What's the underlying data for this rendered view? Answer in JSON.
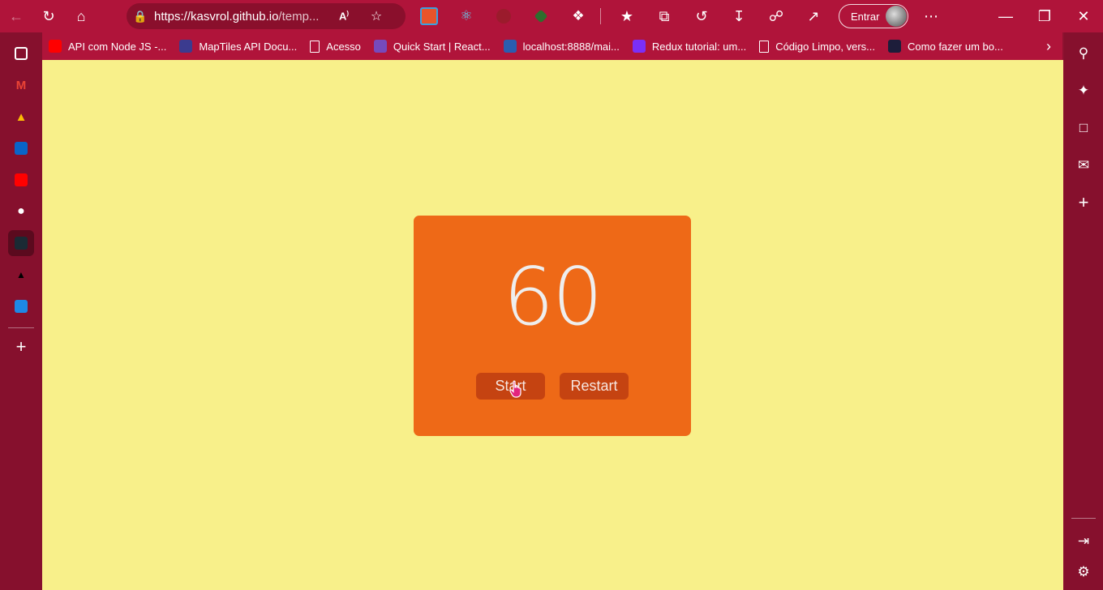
{
  "browser": {
    "url_domain": "https://kasvrol.github.io",
    "url_rest": "/temp...",
    "read_aloud_label": "A",
    "signin_label": "Entrar"
  },
  "favorites": [
    {
      "label": "API com Node JS -...",
      "icon": "youtube-icon",
      "color": "#ff0000"
    },
    {
      "label": "MapTiles API Docu...",
      "icon": "maptiles-icon",
      "color": "#3b3b8f"
    },
    {
      "label": "Acesso",
      "icon": "page-icon",
      "color": "transparent"
    },
    {
      "label": "Quick Start | React...",
      "icon": "redux-icon",
      "color": "#764abc"
    },
    {
      "label": "localhost:8888/mai...",
      "icon": "localhost-icon",
      "color": "#2a5db0"
    },
    {
      "label": "Redux tutorial: um...",
      "icon": "glasses-icon",
      "color": "#7b2ff7"
    },
    {
      "label": "Código Limpo, vers...",
      "icon": "page-icon",
      "color": "transparent"
    },
    {
      "label": "Como fazer um bo...",
      "icon": "bookmark-dark-icon",
      "color": "#1d1d3a"
    }
  ],
  "timer": {
    "value": "60",
    "start_label": "Start",
    "restart_label": "Restart"
  },
  "colors": {
    "page_background": "#f8f08a",
    "card_background": "#ee6917",
    "button_background": "#c54311",
    "chrome": "#b0143a"
  }
}
